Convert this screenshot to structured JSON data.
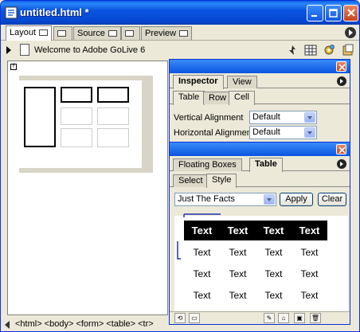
{
  "window": {
    "title": "untitled.html *"
  },
  "tabs": [
    {
      "label": "Layout"
    },
    {
      "label": ""
    },
    {
      "label": "Source"
    },
    {
      "label": ""
    },
    {
      "label": "Preview"
    }
  ],
  "doc": {
    "title": "Welcome to Adobe GoLive 6"
  },
  "statusbar": {
    "tags": "<html> <body> <form> <table> <tr>"
  },
  "inspector": {
    "tabs": [
      "Inspector",
      "View"
    ],
    "subtabs": [
      "Table",
      "Row",
      "Cell"
    ],
    "fields": [
      {
        "label": "Vertical Alignment",
        "value": "Default"
      },
      {
        "label": "Horizontal Alignment",
        "value": "Default"
      }
    ]
  },
  "tablepalette": {
    "tabs": [
      "Floating Boxes",
      "Table"
    ],
    "subtabs": [
      "Select",
      "Style"
    ],
    "style_value": "Just The Facts",
    "apply_label": "Apply",
    "clear_label": "Clear",
    "preview": {
      "header": [
        "Text",
        "Text",
        "Text",
        "Text"
      ],
      "rows": [
        [
          "Text",
          "Text",
          "Text",
          "Text"
        ],
        [
          "Text",
          "Text",
          "Text",
          "Text"
        ],
        [
          "Text",
          "Text",
          "Text",
          "Text"
        ]
      ]
    }
  },
  "colors": {
    "xp_blue": "#0a55e0",
    "close_red": "#c5441f",
    "panel_bg": "#ece9d8"
  }
}
